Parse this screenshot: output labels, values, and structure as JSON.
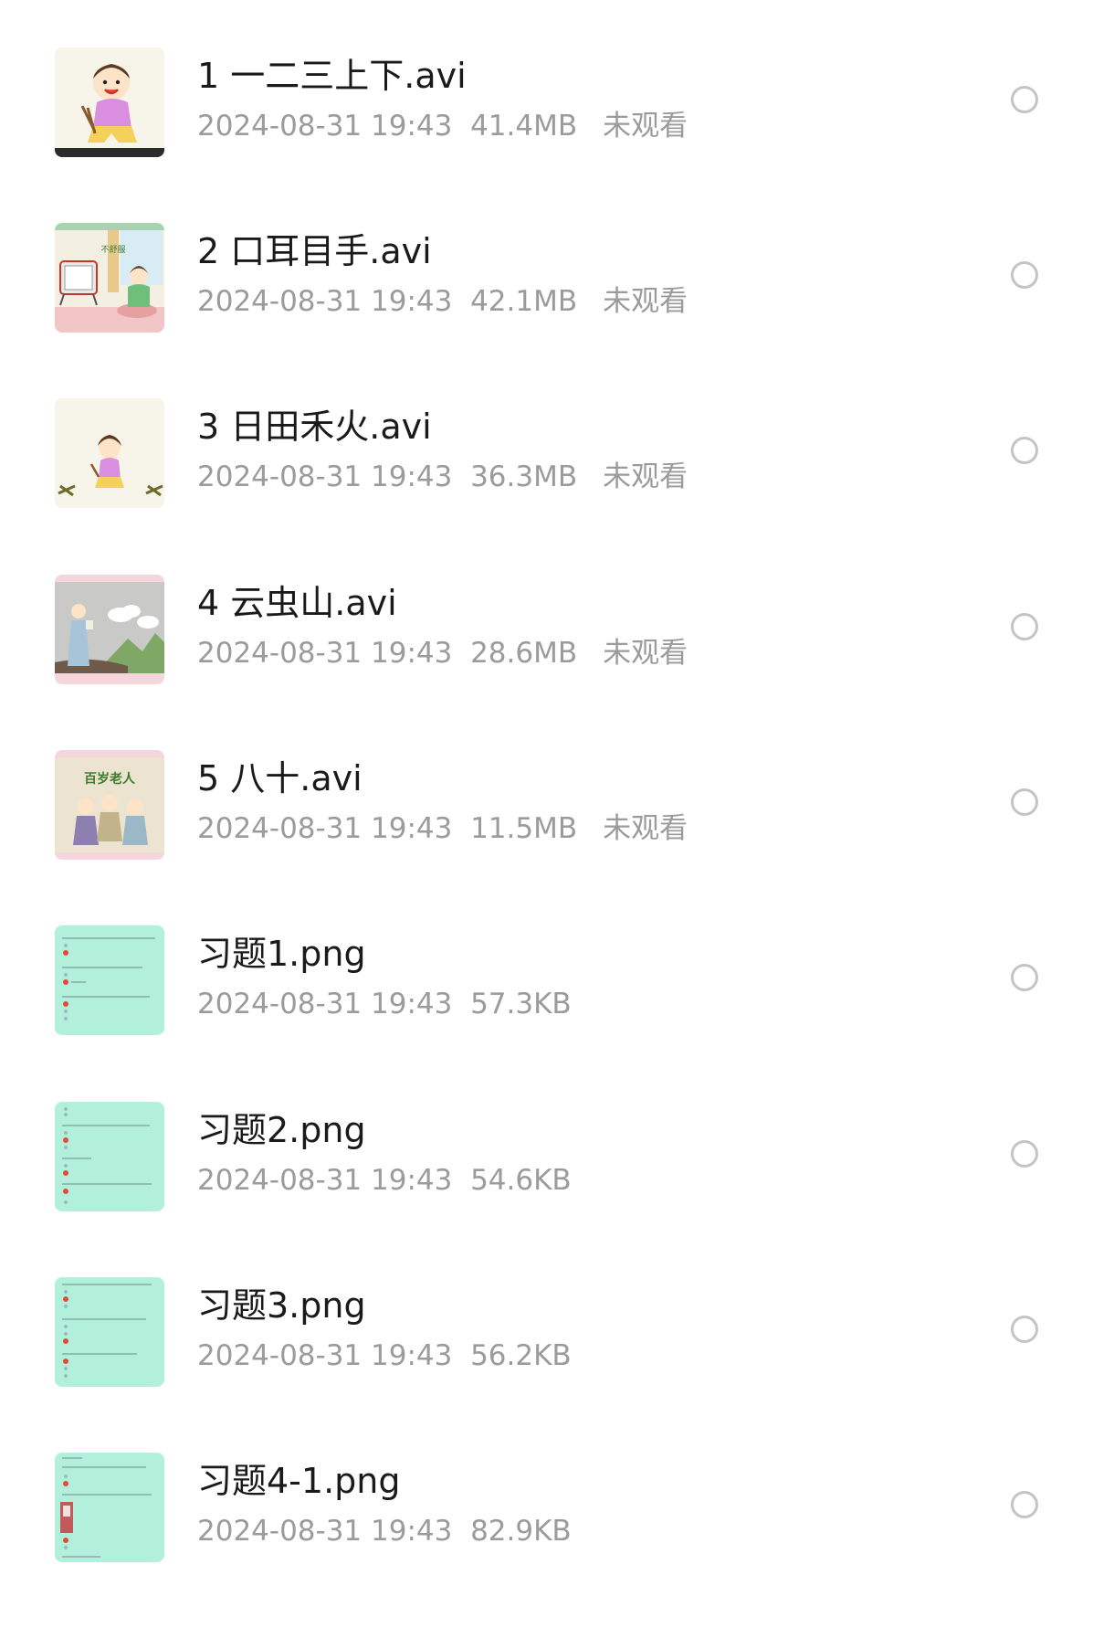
{
  "files": [
    {
      "name": "1 一二三上下.avi",
      "date": "2024-08-31 19:43",
      "size": "41.4MB",
      "status": "未观看",
      "type": "video",
      "thumb_icon": "cartoon-girl-sticks-thumbnail"
    },
    {
      "name": "2 口耳目手.avi",
      "date": "2024-08-31 19:43",
      "size": "42.1MB",
      "status": "未观看",
      "type": "video",
      "thumb_icon": "cartoon-tv-boy-thumbnail",
      "thumb_text": "不舒服"
    },
    {
      "name": "3 日田禾火.avi",
      "date": "2024-08-31 19:43",
      "size": "36.3MB",
      "status": "未观看",
      "type": "video",
      "thumb_icon": "cartoon-girl-fire-thumbnail"
    },
    {
      "name": "4 云虫山.avi",
      "date": "2024-08-31 19:43",
      "size": "28.6MB",
      "status": "未观看",
      "type": "video",
      "thumb_icon": "cartoon-scholar-clouds-thumbnail"
    },
    {
      "name": "5 八十.avi",
      "date": "2024-08-31 19:43",
      "size": "11.5MB",
      "status": "未观看",
      "type": "video",
      "thumb_icon": "cartoon-elders-thumbnail",
      "thumb_text": "百岁老人"
    },
    {
      "name": "习题1.png",
      "date": "2024-08-31 19:43",
      "size": "57.3KB",
      "status": "",
      "type": "image",
      "thumb_icon": "worksheet-thumbnail"
    },
    {
      "name": "习题2.png",
      "date": "2024-08-31 19:43",
      "size": "54.6KB",
      "status": "",
      "type": "image",
      "thumb_icon": "worksheet-thumbnail"
    },
    {
      "name": "习题3.png",
      "date": "2024-08-31 19:43",
      "size": "56.2KB",
      "status": "",
      "type": "image",
      "thumb_icon": "worksheet-thumbnail"
    },
    {
      "name": "习题4-1.png",
      "date": "2024-08-31 19:43",
      "size": "82.9KB",
      "status": "",
      "type": "image",
      "thumb_icon": "worksheet-thumbnail"
    }
  ],
  "colors": {
    "name_text": "#1a1a1a",
    "meta_text": "#9b9b9b",
    "circle_border": "#c4c4c4",
    "worksheet_bg": "#b2f0dc"
  }
}
